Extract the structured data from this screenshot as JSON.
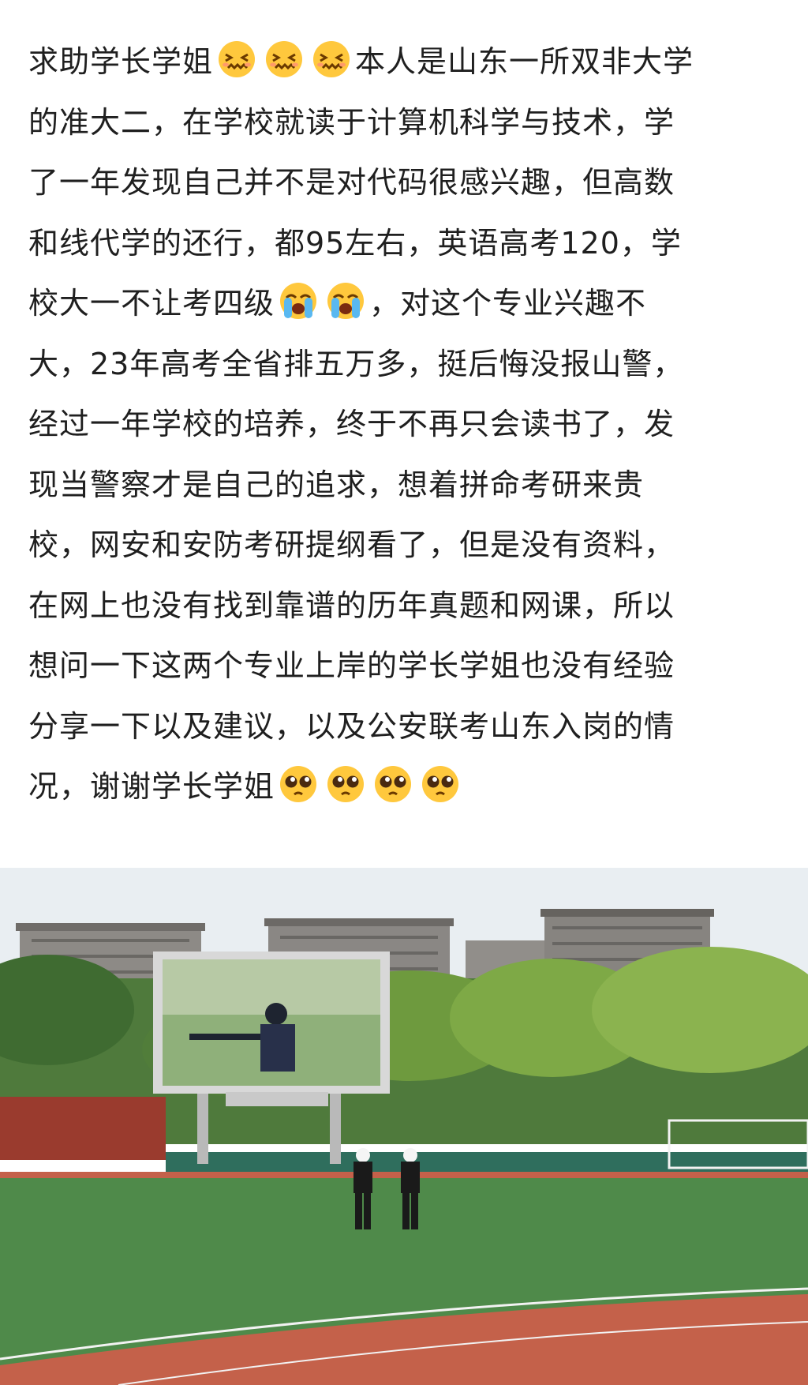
{
  "post": {
    "lines": [
      [
        "求助学长学姐",
        "本人是山东一所双非大学"
      ],
      [
        "的准大二，在学校就读于计算机科学与技术，学"
      ],
      [
        "了一年发现自己并不是对代码很感兴趣，但高数"
      ],
      [
        "和线代学的还行，都95左右，英语高考120，学"
      ],
      [
        "校大一不让考四级",
        "，对这个专业兴趣不"
      ],
      [
        "大，23年高考全省排五万多，挺后悔没报山警，"
      ],
      [
        "经过一年学校的培养，终于不再只会读书了，发"
      ],
      [
        "现当警察才是自己的追求，想着拼命考研来贵"
      ],
      [
        "校，网安和安防考研提纲看了，但是没有资料，"
      ],
      [
        "在网上也没有找到靠谱的历年真题和网课，所以"
      ],
      [
        "想问一下这两个专业上岸的学长学姐也没有经验"
      ],
      [
        "分享一下以及建议，以及公安联考山东入岗的情"
      ],
      [
        "况，谢谢学长学姐"
      ]
    ],
    "emoji_icons": [
      "confounded-face-icon",
      "loudly-crying-face-icon",
      "pleading-face-icon"
    ]
  },
  "colors": {
    "text": "#1f1f1f",
    "emoji_yellow": "#ffc83d",
    "sky": "#e9eef2",
    "grass": "#4f8a4a",
    "track": "#c4614a"
  }
}
